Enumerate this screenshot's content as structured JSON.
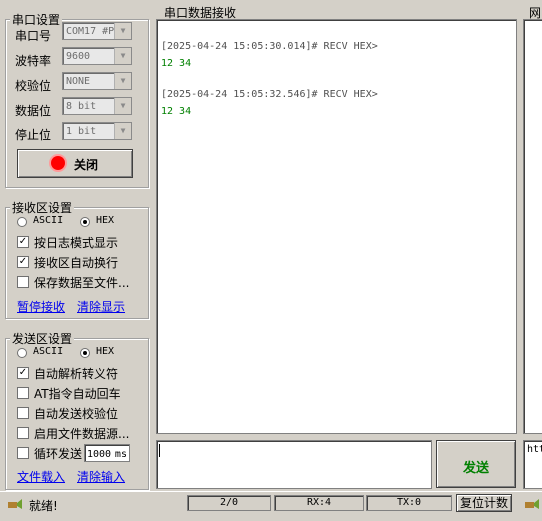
{
  "serial_settings": {
    "title": "串口设置",
    "port_label": "串口号",
    "port_value": "COM17 #P",
    "baud_label": "波特率",
    "baud_value": "9600",
    "parity_label": "校验位",
    "parity_value": "NONE",
    "databits_label": "数据位",
    "databits_value": "8 bit",
    "stopbits_label": "停止位",
    "stopbits_value": "1 bit",
    "toggle_button_label": "关闭",
    "status_color": "#ff0000"
  },
  "receive_settings": {
    "title": "接收区设置",
    "ascii_label": "ASCII",
    "hex_label": "HEX",
    "mode_selected": "HEX",
    "log_mode_label": "按日志模式显示",
    "log_mode_checked": true,
    "auto_wrap_label": "接收区自动换行",
    "auto_wrap_checked": true,
    "save_file_label": "保存数据至文件...",
    "save_file_checked": false,
    "pause_link": "暂停接收",
    "clear_link": "清除显示"
  },
  "send_settings": {
    "title": "发送区设置",
    "ascii_label": "ASCII",
    "hex_label": "HEX",
    "mode_selected": "HEX",
    "auto_parse_label": "自动解析转义符",
    "auto_parse_checked": true,
    "at_return_label": "AT指令自动回车",
    "at_return_checked": false,
    "auto_checksum_label": "自动发送校验位",
    "auto_checksum_checked": false,
    "file_source_label": "启用文件数据源...",
    "file_source_checked": false,
    "loop_send_label": "循环发送",
    "loop_send_checked": false,
    "loop_interval": "1000",
    "loop_unit": "ms",
    "load_file_link": "文件载入",
    "clear_input_link": "清除输入"
  },
  "receive_panel": {
    "title": "串口数据接收",
    "log": [
      {
        "header": "[2025-04-24 15:05:30.014]# RECV HEX>",
        "data": "12 34"
      },
      {
        "header": "[2025-04-24 15:05:32.546]# RECV HEX>",
        "data": "12 34"
      }
    ],
    "data_color": "#008000"
  },
  "send_panel": {
    "input_value": "",
    "send_button_label": "发送",
    "send_color": "#008000"
  },
  "right_panel": {
    "title": "网",
    "partial_text": "htt"
  },
  "status_bar": {
    "ready_text": "就绪!",
    "pages": "2/0",
    "rx": "RX:4",
    "tx": "TX:0",
    "reset_button_label": "复位计数"
  }
}
